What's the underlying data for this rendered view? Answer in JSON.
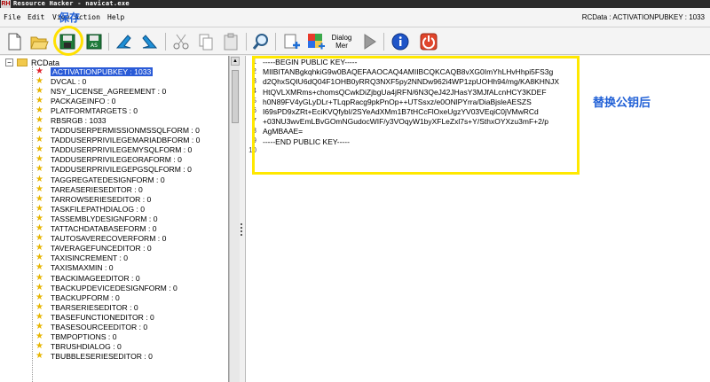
{
  "window": {
    "logo": "RH",
    "title": "Resource Hacker - navicat.exe"
  },
  "menu": {
    "items": [
      "File",
      "Edit",
      "View",
      "Action",
      "Help"
    ],
    "status": "RCData : ACTIVATIONPUBKEY : 1033"
  },
  "annotations": {
    "save": "保存",
    "replace": "替换公钥后"
  },
  "toolbar": {
    "dialog_label": "Dialog",
    "dialog_sub": "Mer"
  },
  "tree": {
    "root": "RCData",
    "expander": "−",
    "selected_index": 0,
    "items": [
      "ACTIVATIONPUBKEY : 1033",
      "DVCAL : 0",
      "NSY_LICENSE_AGREEMENT : 0",
      "PACKAGEINFO : 0",
      "PLATFORMTARGETS : 0",
      "RBSRGB : 1033",
      "TADDUSERPERMISSIONMSSQLFORM : 0",
      "TADDUSERPRIVILEGEMARIADBFORM : 0",
      "TADDUSERPRIVILEGEMYSQLFORM : 0",
      "TADDUSERPRIVILEGEORAFORM : 0",
      "TADDUSERPRIVILEGEPGSQLFORM : 0",
      "TAGGREGATEDESIGNFORM : 0",
      "TAREASERIESEDITOR : 0",
      "TARROWSERIESEDITOR : 0",
      "TASKFILEPATHDIALOG : 0",
      "TASSEMBLYDESIGNFORM : 0",
      "TATTACHDATABASEFORM : 0",
      "TAUTOSAVERECOVERFORM : 0",
      "TAVERAGEFUNCEDITOR : 0",
      "TAXISINCREMENT : 0",
      "TAXISMAXMIN : 0",
      "TBACKIMAGEEDITOR : 0",
      "TBACKUPDEVICEDESIGNFORM : 0",
      "TBACKUPFORM : 0",
      "TBARSERIESEDITOR : 0",
      "TBASEFUNCTIONEDITOR : 0",
      "TBASESOURCEEDITOR : 0",
      "TBMPOPTIONS : 0",
      "TBRUSHDIALOG : 0",
      "TBUBBLESERIESEDITOR : 0"
    ]
  },
  "editor": {
    "line_numbers": [
      "1",
      "2",
      "3",
      "4",
      "5",
      "6",
      "7",
      "8",
      "9",
      "10"
    ],
    "lines": [
      "-----BEGIN PUBLIC KEY-----",
      "MIIBITANBgkqhkiG9w0BAQEFAAOCAQ4AMIIBCQKCAQB8vXG0ImYhLHvHhpi5FS3g",
      "d2QhxSQIU6dQ04F1OHB0yRRQ3NXF5py2NNDw962i4WP1zpUOHh94/mg/KA8KHNJX",
      "HtQVLXMRms+chomsQCwkDiZjbgUa4jRFN/6N3QeJ42JHasY3MJfALcnHCY3KDEF",
      "h0N89FV4yGLyDLr+TLqpRacg9pkPnOp++UTSsxz/e0ONlPYrra/DiaBjsleAESZS",
      "I69sPD9xZRt+EciKVQfybI/2SYeAdXMm1B7tHCcFlOxeUgzYV03VEqiC0jVMwRCd",
      "+03NU3wvEmLBvGOmNGudocWIF/y3VOqyW1byXFLeZxl7s+Y/SthxOYXzu3mF+2/p",
      "AgMBAAE=",
      "-----END PUBLIC KEY-----",
      ""
    ]
  }
}
